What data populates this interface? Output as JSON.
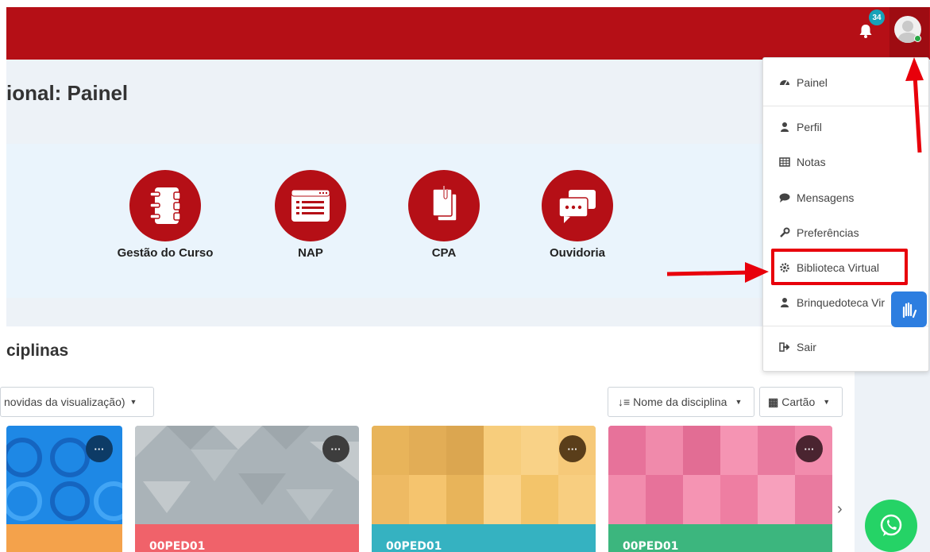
{
  "header": {
    "notification_count": "34",
    "brand_color": "#b50f16"
  },
  "page": {
    "title": "ional: Painel"
  },
  "quick_links": [
    {
      "label": "Gestão do Curso",
      "icon": "notebook-icon"
    },
    {
      "label": "NAP",
      "icon": "list-window-icon"
    },
    {
      "label": "CPA",
      "icon": "clipped-documents-icon"
    },
    {
      "label": "Ouvidoria",
      "icon": "chat-bubbles-icon"
    }
  ],
  "courses": {
    "section_title": "ciplinas",
    "filter_label": "novidas da visualização)",
    "sort_label": "Nome da disciplina",
    "view_label": "Cartão",
    "cards": [
      {
        "code": "",
        "image_color": "#1e88e5",
        "footer_color": "#f4a24b"
      },
      {
        "code": "00PED01",
        "image_color": "#aab3b8",
        "footer_color": "#f0626a"
      },
      {
        "code": "00PED01",
        "image_color": "#f3c46a",
        "footer_color": "#35b2c1"
      },
      {
        "code": "00PED01",
        "image_color": "#ee7ea2",
        "footer_color": "#3cb67e"
      }
    ]
  },
  "user_menu": {
    "items": [
      {
        "label": "Painel",
        "icon": "dashboard-icon"
      },
      {
        "label": "Perfil",
        "icon": "user-icon"
      },
      {
        "label": "Notas",
        "icon": "table-icon"
      },
      {
        "label": "Mensagens",
        "icon": "speech-bubble-icon"
      },
      {
        "label": "Preferências",
        "icon": "wrench-icon"
      },
      {
        "label": "Biblioteca Virtual",
        "icon": "gear-icon"
      },
      {
        "label": "Brinquedoteca Vir",
        "icon": "user-icon"
      },
      {
        "label": "Sair",
        "icon": "sign-out-icon"
      }
    ],
    "highlight_color": "#e8000b"
  }
}
